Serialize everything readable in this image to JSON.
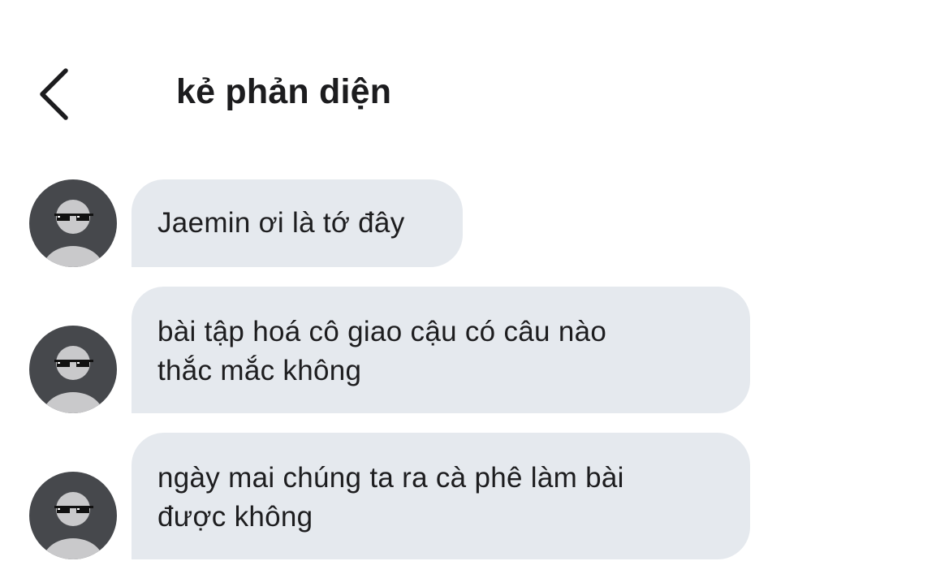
{
  "header": {
    "title": "kẻ phản diện",
    "back_icon": "chevron-left-icon"
  },
  "avatar": {
    "icon": "avatar-sunglasses-icon",
    "colors": {
      "background": "#46484c",
      "figure": "#c9c9cb"
    }
  },
  "messages": [
    {
      "text": "Jaemin ơi là tớ đây"
    },
    {
      "text": "bài tập hoá cô giao cậu có câu nào\nthắc mắc không"
    },
    {
      "text": "ngày mai chúng ta ra cà phê làm bài\nđược không"
    }
  ],
  "colors": {
    "bubble_background": "#e5e9ee",
    "text": "#1d1d1f"
  }
}
